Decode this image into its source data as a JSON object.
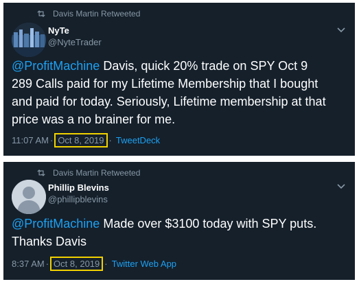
{
  "tweets": [
    {
      "retweet_label": "Davis Martin Retweeted",
      "author_name": "NyTe",
      "author_handle": "@NyteTrader",
      "mention": "@ProfitMachine",
      "body": " Davis, quick 20% trade on SPY Oct 9\n289 Calls paid for my Lifetime Membership that I bought\nand paid for today. Seriously, Lifetime membership at that\nprice was a no brainer for me.",
      "time": "11:07 AM",
      "separator": "·",
      "date": "Oct 8, 2019",
      "source": "TweetDeck"
    },
    {
      "retweet_label": "Davis Martin Retweeted",
      "author_name": "Phillip Blevins",
      "author_handle": "@phillipblevins",
      "mention": "@ProfitMachine",
      "body": " Made over $3100 today with SPY puts.\nThanks Davis",
      "time": "8:37 AM",
      "separator": "·",
      "date": "Oct 8, 2019",
      "source": "Twitter Web App"
    }
  ],
  "colors": {
    "background": "#15202b",
    "link": "#1da1f2",
    "secondary_text": "#8899a6",
    "highlight_box": "#f2d200"
  }
}
